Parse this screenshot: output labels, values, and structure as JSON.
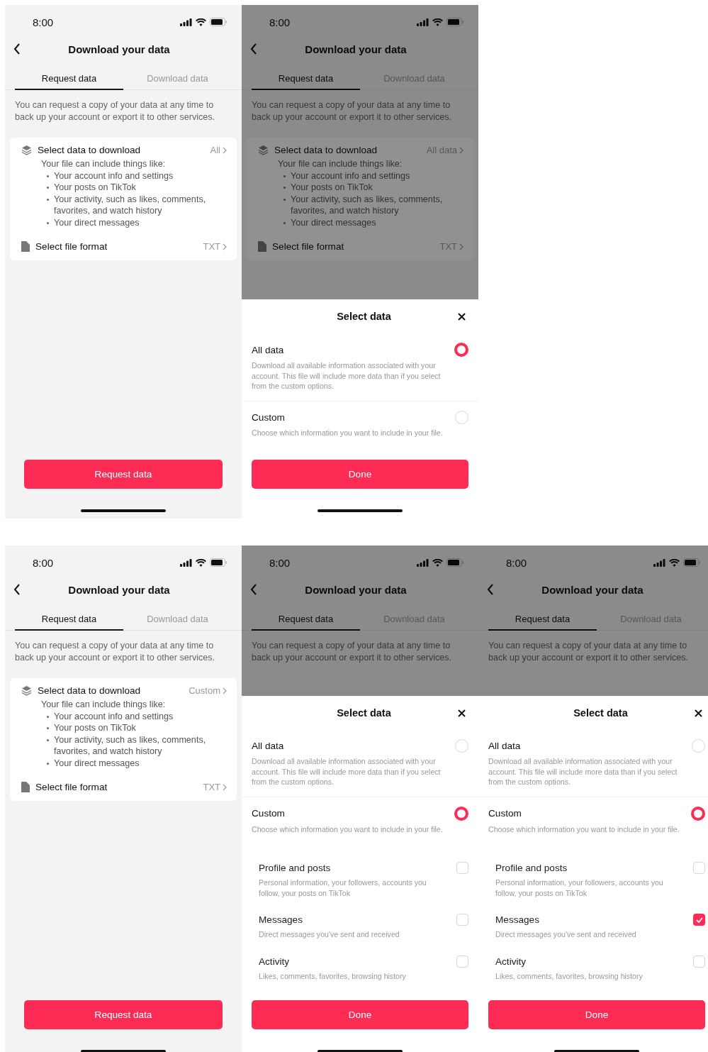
{
  "screens": [
    {
      "dimmed": false,
      "time": "8:00",
      "title": "Download your data",
      "tabs": [
        {
          "label": "Request data",
          "selected": true
        },
        {
          "label": "Download data",
          "selected": false
        }
      ],
      "intro": "You can request a copy of your data at any time to back up your account or export it to other services.",
      "card": {
        "rows": [
          {
            "kind": "data",
            "label": "Select data to download",
            "value": "All",
            "lead": "Your file can include things like:",
            "bullets": [
              "Your account info and settings",
              "Your posts on TikTok",
              "Your activity, such as likes, comments, favorites, and watch history",
              "Your direct messages"
            ]
          },
          {
            "kind": "format",
            "label": "Select file format",
            "value": "TXT"
          }
        ]
      },
      "button": "Request data"
    },
    {
      "dimmed": true,
      "time": "8:00",
      "title": "Download your data",
      "tabs": [
        {
          "label": "Request data",
          "selected": true
        },
        {
          "label": "Download data",
          "selected": false
        }
      ],
      "intro": "You can request a copy of your data at any time to back up your account or export it to other services.",
      "card": {
        "rows": [
          {
            "kind": "data",
            "label": "Select data to download",
            "value": "All data",
            "lead": "Your file can include things like:",
            "bullets": [
              "Your account info and settings",
              "Your posts on TikTok",
              "Your activity, such as likes, comments, favorites, and watch history",
              "Your direct messages"
            ]
          },
          {
            "kind": "format",
            "label": "Select file format",
            "value": "TXT"
          }
        ]
      },
      "sheet": {
        "title": "Select data",
        "options": [
          {
            "label": "All data",
            "description": "Download all available information associated with your account. This file will include more data than if you select from the custom options.",
            "selected": true
          },
          {
            "label": "Custom",
            "description": "Choose which information you want to include in your file.",
            "selected": false
          }
        ],
        "button": "Done"
      }
    },
    {
      "dimmed": false,
      "time": "8:00",
      "title": "Download your data",
      "tabs": [
        {
          "label": "Request data",
          "selected": true
        },
        {
          "label": "Download data",
          "selected": false
        }
      ],
      "intro": "You can request a copy of your data at any time to back up your account or export it to other services.",
      "card": {
        "rows": [
          {
            "kind": "data",
            "label": "Select data to download",
            "value": "Custom",
            "lead": "Your file can include things like:",
            "bullets": [
              "Your account info and settings",
              "Your posts on TikTok",
              "Your activity, such as likes, comments, favorites, and watch history",
              "Your direct messages"
            ]
          },
          {
            "kind": "format",
            "label": "Select file format",
            "value": "TXT"
          }
        ]
      },
      "button": "Request data"
    },
    {
      "dimmed": true,
      "time": "8:00",
      "title": "Download your data",
      "tabs": [
        {
          "label": "Request data",
          "selected": true
        },
        {
          "label": "Download data",
          "selected": false
        }
      ],
      "intro": "You can request a copy of your data at any time to back up your account or export it to other services.",
      "sheet": {
        "title": "Select data",
        "options": [
          {
            "label": "All data",
            "description": "Download all available information associated with your account. This file will include more data than if you select from the custom options.",
            "selected": false
          },
          {
            "label": "Custom",
            "description": "Choose which information you want to include in your file.",
            "selected": true,
            "children": [
              {
                "label": "Profile and posts",
                "description": "Personal information, your followers, accounts you follow, your posts on TikTok",
                "checked": false
              },
              {
                "label": "Messages",
                "description": "Direct messages you've sent and received",
                "checked": false
              },
              {
                "label": "Activity",
                "description": "Likes, comments, favorites, browsing history",
                "checked": false
              }
            ]
          }
        ],
        "button": "Done"
      }
    },
    {
      "dimmed": true,
      "time": "8:00",
      "title": "Download your data",
      "tabs": [
        {
          "label": "Request data",
          "selected": true
        },
        {
          "label": "Download data",
          "selected": false
        }
      ],
      "intro": "You can request a copy of your data at any time to back up your account or export it to other services.",
      "sheet": {
        "title": "Select data",
        "options": [
          {
            "label": "All data",
            "description": "Download all available information associated with your account. This file will include more data than if you select from the custom options.",
            "selected": false
          },
          {
            "label": "Custom",
            "description": "Choose which information you want to include in your file.",
            "selected": true,
            "children": [
              {
                "label": "Profile and posts",
                "description": "Personal information, your followers, accounts you follow, your posts on TikTok",
                "checked": false
              },
              {
                "label": "Messages",
                "description": "Direct messages you've sent and received",
                "checked": true
              },
              {
                "label": "Activity",
                "description": "Likes, comments, favorites, browsing history",
                "checked": false
              }
            ]
          }
        ],
        "button": "Done"
      }
    }
  ]
}
